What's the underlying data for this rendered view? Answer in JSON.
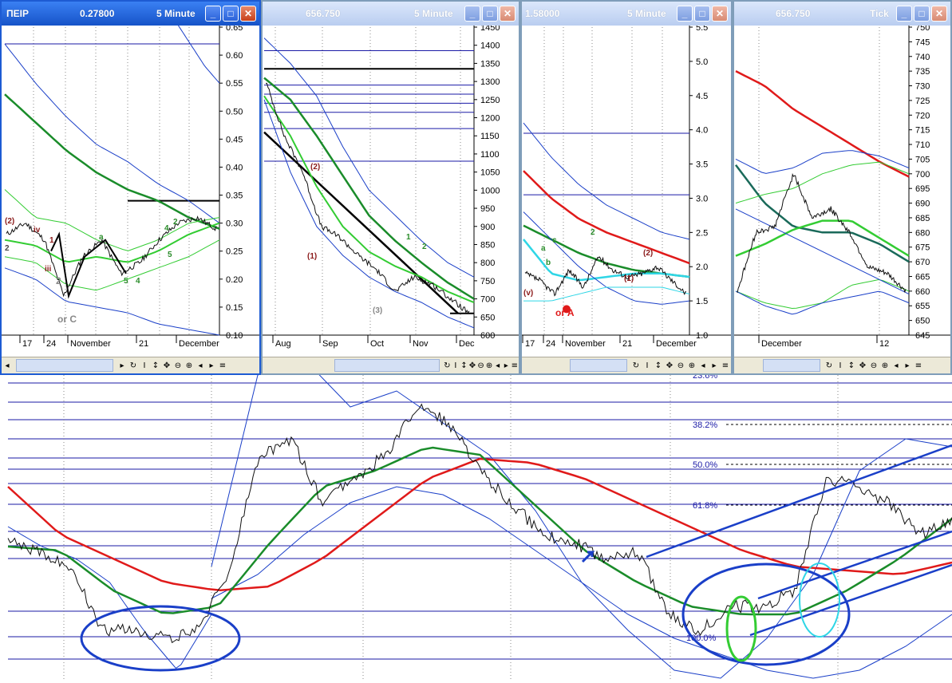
{
  "colors": {
    "blue": "#1a3fc8",
    "green": "#1a8c2a",
    "lightgreen": "#33cc33",
    "red": "#e01a1a",
    "cyan": "#2fd6e6",
    "black": "#000000",
    "hline": "#1a1aa6"
  },
  "windows": [
    {
      "symbol": "ΠΕΙΡ",
      "price": "0.27800",
      "interval": "5 Minute",
      "active": true,
      "yticks": [
        "0.65",
        "0.60",
        "0.55",
        "0.50",
        "0.45",
        "0.40",
        "0.35",
        "0.30",
        "0.25",
        "0.20",
        "0.15",
        "0.10"
      ],
      "xlabels": [
        "17",
        "24",
        "November",
        "21",
        "December"
      ],
      "annotations": [
        "(2)",
        "2",
        "iv",
        "1",
        "2",
        "iii",
        "3",
        "1",
        "2",
        "1",
        "3",
        "4",
        "a",
        "b",
        "c",
        "5",
        "3",
        "4",
        "5",
        "2",
        "4",
        "2",
        "or C"
      ]
    },
    {
      "symbol": "",
      "price": "656.750",
      "interval": "5 Minute",
      "active": false,
      "yticks": [
        "1450",
        "1400",
        "1350",
        "1300",
        "1250",
        "1200",
        "1150",
        "1100",
        "1050",
        "1000",
        "950",
        "900",
        "850",
        "800",
        "750",
        "700",
        "650",
        "600"
      ],
      "xlabels": [
        "Aug",
        "Sep",
        "Oct",
        "Nov",
        "Dec"
      ],
      "annotations": [
        "(2)",
        "(1)",
        "(3)",
        "1",
        "2"
      ]
    },
    {
      "symbol": "",
      "price": "1.58000",
      "interval": "5 Minute",
      "active": false,
      "yticks": [
        "5.5",
        "5.0",
        "4.5",
        "4.0",
        "3.5",
        "3.0",
        "2.5",
        "2.0",
        "1.5",
        "1.0"
      ],
      "xlabels": [
        "17",
        "24",
        "November",
        "21",
        "December"
      ],
      "annotations": [
        "a",
        "c",
        "b",
        "1",
        "2",
        "i",
        "1",
        "2",
        "1",
        "(1)",
        "2",
        "(2)",
        "(v)",
        "2",
        "or A"
      ]
    },
    {
      "symbol": "",
      "price": "656.750",
      "interval": "Tick",
      "active": false,
      "yticks": [
        "750",
        "745",
        "740",
        "735",
        "730",
        "725",
        "720",
        "715",
        "710",
        "705",
        "700",
        "695",
        "690",
        "685",
        "680",
        "675",
        "670",
        "665",
        "660",
        "655",
        "650",
        "645"
      ],
      "xlabels": [
        "December",
        "12"
      ],
      "annotations": []
    }
  ],
  "fib_levels": [
    "23.6%",
    "38.2%",
    "50.0%",
    "61.8%",
    "100.0%"
  ],
  "chart_data": [
    {
      "type": "line",
      "title": "",
      "xlabel": "",
      "ylabel": "",
      "ylim": [
        0.1,
        0.65
      ],
      "x": [
        "17",
        "24",
        "November",
        "21",
        "December"
      ],
      "series": [
        {
          "values": [
            0.28,
            0.3,
            0.27,
            0.17,
            0.24,
            0.27,
            0.21,
            0.23,
            0.27,
            0.3,
            0.31,
            0.29
          ]
        }
      ]
    },
    {
      "type": "line",
      "title": "",
      "xlabel": "",
      "ylabel": "",
      "ylim": [
        600,
        1450
      ],
      "x": [
        "Aug",
        "Sep",
        "Oct",
        "Nov",
        "Dec"
      ],
      "series": [
        {
          "values": [
            1300,
            1150,
            1050,
            900,
            870,
            820,
            780,
            720,
            760,
            740,
            700,
            660
          ]
        }
      ]
    },
    {
      "type": "line",
      "title": "",
      "xlabel": "",
      "ylabel": "",
      "ylim": [
        1.0,
        5.5
      ],
      "x": [
        "17",
        "24",
        "November",
        "21",
        "December"
      ],
      "series": [
        {
          "values": [
            1.9,
            1.8,
            1.6,
            1.95,
            1.7,
            2.15,
            1.95,
            1.85,
            1.9,
            2.0,
            1.8,
            1.6
          ]
        }
      ]
    },
    {
      "type": "line",
      "title": "",
      "xlabel": "",
      "ylabel": "",
      "ylim": [
        645,
        750
      ],
      "x": [
        "December",
        "12"
      ],
      "series": [
        {
          "values": [
            660,
            680,
            682,
            700,
            685,
            688,
            680,
            668,
            666,
            660
          ]
        }
      ]
    }
  ]
}
